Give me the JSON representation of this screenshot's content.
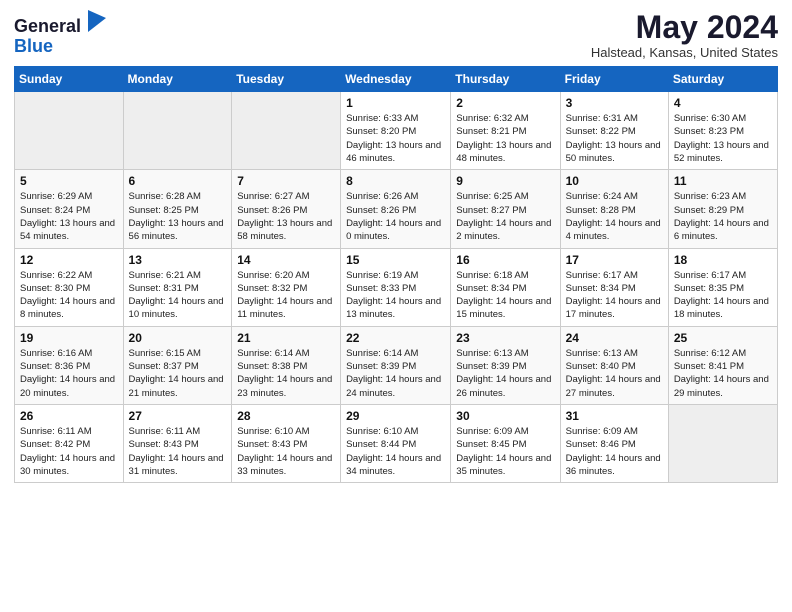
{
  "header": {
    "logo_general": "General",
    "logo_blue": "Blue",
    "month_title": "May 2024",
    "location": "Halstead, Kansas, United States"
  },
  "days_of_week": [
    "Sunday",
    "Monday",
    "Tuesday",
    "Wednesday",
    "Thursday",
    "Friday",
    "Saturday"
  ],
  "weeks": [
    [
      {
        "day": "",
        "empty": true
      },
      {
        "day": "",
        "empty": true
      },
      {
        "day": "",
        "empty": true
      },
      {
        "day": "1",
        "sunrise": "6:33 AM",
        "sunset": "8:20 PM",
        "daylight": "13 hours and 46 minutes."
      },
      {
        "day": "2",
        "sunrise": "6:32 AM",
        "sunset": "8:21 PM",
        "daylight": "13 hours and 48 minutes."
      },
      {
        "day": "3",
        "sunrise": "6:31 AM",
        "sunset": "8:22 PM",
        "daylight": "13 hours and 50 minutes."
      },
      {
        "day": "4",
        "sunrise": "6:30 AM",
        "sunset": "8:23 PM",
        "daylight": "13 hours and 52 minutes."
      }
    ],
    [
      {
        "day": "5",
        "sunrise": "6:29 AM",
        "sunset": "8:24 PM",
        "daylight": "13 hours and 54 minutes."
      },
      {
        "day": "6",
        "sunrise": "6:28 AM",
        "sunset": "8:25 PM",
        "daylight": "13 hours and 56 minutes."
      },
      {
        "day": "7",
        "sunrise": "6:27 AM",
        "sunset": "8:26 PM",
        "daylight": "13 hours and 58 minutes."
      },
      {
        "day": "8",
        "sunrise": "6:26 AM",
        "sunset": "8:26 PM",
        "daylight": "14 hours and 0 minutes."
      },
      {
        "day": "9",
        "sunrise": "6:25 AM",
        "sunset": "8:27 PM",
        "daylight": "14 hours and 2 minutes."
      },
      {
        "day": "10",
        "sunrise": "6:24 AM",
        "sunset": "8:28 PM",
        "daylight": "14 hours and 4 minutes."
      },
      {
        "day": "11",
        "sunrise": "6:23 AM",
        "sunset": "8:29 PM",
        "daylight": "14 hours and 6 minutes."
      }
    ],
    [
      {
        "day": "12",
        "sunrise": "6:22 AM",
        "sunset": "8:30 PM",
        "daylight": "14 hours and 8 minutes."
      },
      {
        "day": "13",
        "sunrise": "6:21 AM",
        "sunset": "8:31 PM",
        "daylight": "14 hours and 10 minutes."
      },
      {
        "day": "14",
        "sunrise": "6:20 AM",
        "sunset": "8:32 PM",
        "daylight": "14 hours and 11 minutes."
      },
      {
        "day": "15",
        "sunrise": "6:19 AM",
        "sunset": "8:33 PM",
        "daylight": "14 hours and 13 minutes."
      },
      {
        "day": "16",
        "sunrise": "6:18 AM",
        "sunset": "8:34 PM",
        "daylight": "14 hours and 15 minutes."
      },
      {
        "day": "17",
        "sunrise": "6:17 AM",
        "sunset": "8:34 PM",
        "daylight": "14 hours and 17 minutes."
      },
      {
        "day": "18",
        "sunrise": "6:17 AM",
        "sunset": "8:35 PM",
        "daylight": "14 hours and 18 minutes."
      }
    ],
    [
      {
        "day": "19",
        "sunrise": "6:16 AM",
        "sunset": "8:36 PM",
        "daylight": "14 hours and 20 minutes."
      },
      {
        "day": "20",
        "sunrise": "6:15 AM",
        "sunset": "8:37 PM",
        "daylight": "14 hours and 21 minutes."
      },
      {
        "day": "21",
        "sunrise": "6:14 AM",
        "sunset": "8:38 PM",
        "daylight": "14 hours and 23 minutes."
      },
      {
        "day": "22",
        "sunrise": "6:14 AM",
        "sunset": "8:39 PM",
        "daylight": "14 hours and 24 minutes."
      },
      {
        "day": "23",
        "sunrise": "6:13 AM",
        "sunset": "8:39 PM",
        "daylight": "14 hours and 26 minutes."
      },
      {
        "day": "24",
        "sunrise": "6:13 AM",
        "sunset": "8:40 PM",
        "daylight": "14 hours and 27 minutes."
      },
      {
        "day": "25",
        "sunrise": "6:12 AM",
        "sunset": "8:41 PM",
        "daylight": "14 hours and 29 minutes."
      }
    ],
    [
      {
        "day": "26",
        "sunrise": "6:11 AM",
        "sunset": "8:42 PM",
        "daylight": "14 hours and 30 minutes."
      },
      {
        "day": "27",
        "sunrise": "6:11 AM",
        "sunset": "8:43 PM",
        "daylight": "14 hours and 31 minutes."
      },
      {
        "day": "28",
        "sunrise": "6:10 AM",
        "sunset": "8:43 PM",
        "daylight": "14 hours and 33 minutes."
      },
      {
        "day": "29",
        "sunrise": "6:10 AM",
        "sunset": "8:44 PM",
        "daylight": "14 hours and 34 minutes."
      },
      {
        "day": "30",
        "sunrise": "6:09 AM",
        "sunset": "8:45 PM",
        "daylight": "14 hours and 35 minutes."
      },
      {
        "day": "31",
        "sunrise": "6:09 AM",
        "sunset": "8:46 PM",
        "daylight": "14 hours and 36 minutes."
      },
      {
        "day": "",
        "empty": true
      }
    ]
  ]
}
